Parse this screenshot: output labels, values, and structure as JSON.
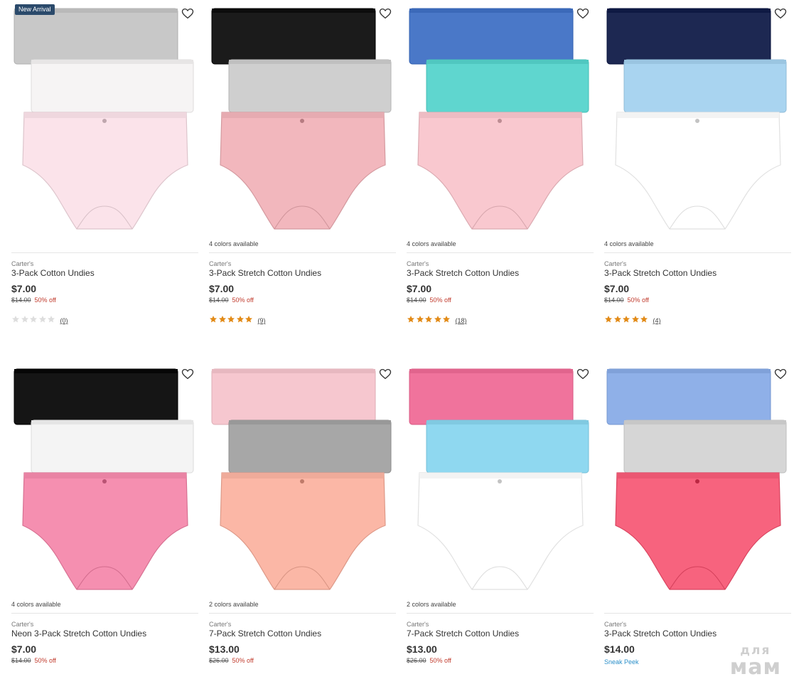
{
  "products": [
    {
      "badge": "New Arrival",
      "colors_available": "",
      "brand": "Carter's",
      "name": "3-Pack Cotton Undies",
      "price": "$7.00",
      "was_price": "$14.00",
      "discount": "50% off",
      "rating": 0,
      "review_count": "(0)",
      "panties": [
        "#c8c8c8",
        "#f6f4f4",
        "#fbe3ea"
      ]
    },
    {
      "badge": "",
      "colors_available": "4 colors available",
      "brand": "Carter's",
      "name": "3-Pack Stretch Cotton Undies",
      "price": "$7.00",
      "was_price": "$14.00",
      "discount": "50% off",
      "rating": 5,
      "review_count": "(9)",
      "panties": [
        "#1b1b1b",
        "#cfcfcf",
        "#f2b7bd"
      ]
    },
    {
      "badge": "",
      "colors_available": "4 colors available",
      "brand": "Carter's",
      "name": "3-Pack Stretch Cotton Undies",
      "price": "$7.00",
      "was_price": "$14.00",
      "discount": "50% off",
      "rating": 5,
      "review_count": "(18)",
      "panties": [
        "#4a78c8",
        "#5fd6cf",
        "#f9c8cf"
      ]
    },
    {
      "badge": "",
      "colors_available": "4 colors available",
      "brand": "Carter's",
      "name": "3-Pack Stretch Cotton Undies",
      "price": "$7.00",
      "was_price": "$14.00",
      "discount": "50% off",
      "rating": 5,
      "review_count": "(4)",
      "panties": [
        "#1d2852",
        "#a9d4f0",
        "#ffffff"
      ]
    },
    {
      "badge": "",
      "colors_available": "4 colors available",
      "brand": "Carter's",
      "name": "Neon 3-Pack Stretch Cotton Undies",
      "price": "$7.00",
      "was_price": "$14.00",
      "discount": "50% off",
      "rating": null,
      "review_count": "",
      "panties": [
        "#151515",
        "#f4f4f4",
        "#f58fb0"
      ]
    },
    {
      "badge": "",
      "colors_available": "2 colors available",
      "brand": "Carter's",
      "name": "7-Pack Stretch Cotton Undies",
      "price": "$13.00",
      "was_price": "$26.00",
      "discount": "50% off",
      "rating": null,
      "review_count": "",
      "panties": [
        "#f6c7cf",
        "#a7a7a7",
        "#fbb7a6"
      ]
    },
    {
      "badge": "",
      "colors_available": "2 colors available",
      "brand": "Carter's",
      "name": "7-Pack Stretch Cotton Undies",
      "price": "$13.00",
      "was_price": "$26.00",
      "discount": "50% off",
      "rating": null,
      "review_count": "",
      "panties": [
        "#f0739c",
        "#8fd8f0",
        "#ffffff"
      ]
    },
    {
      "badge": "",
      "colors_available": "",
      "brand": "Carter's",
      "name": "3-Pack Stretch Cotton Undies",
      "price": "$14.00",
      "was_price": "",
      "discount": "",
      "sneak_peek": "Sneak Peek",
      "rating": null,
      "review_count": "",
      "panties": [
        "#8fb0e8",
        "#d6d6d6",
        "#f7637e"
      ]
    }
  ],
  "colors": {
    "star_filled": "#e28a16",
    "star_empty": "#dddddd",
    "discount": "#c0392b",
    "sneak_peek": "#2a8fc9",
    "badge_bg": "#2b4a6b"
  },
  "icons": {
    "wishlist": "heart-outline-icon",
    "rating": "star-icon"
  },
  "watermark": {
    "top": "для",
    "bottom": "мам"
  }
}
